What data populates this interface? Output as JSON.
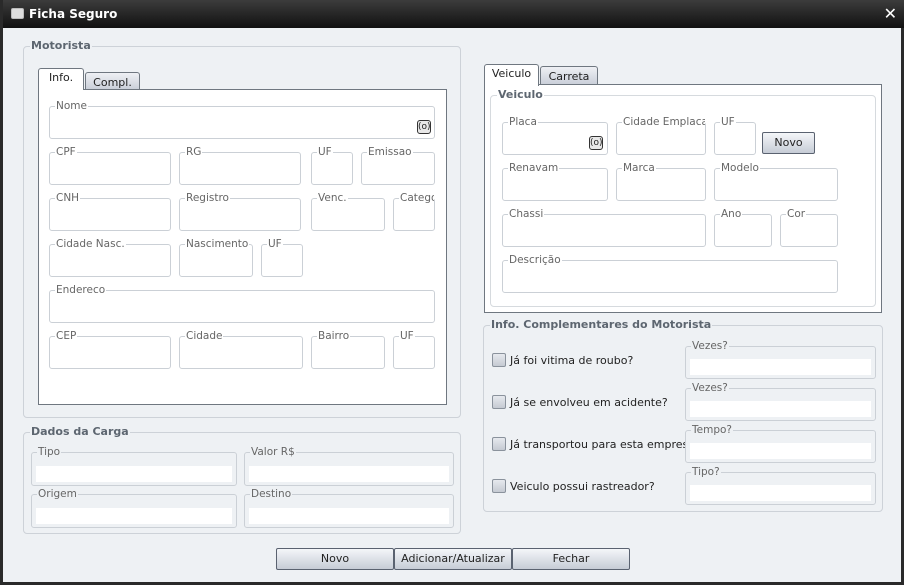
{
  "window": {
    "title": "Ficha Seguro",
    "close": "✕"
  },
  "motorista": {
    "title": "Motorista",
    "tabs": [
      "Info.",
      "Compl."
    ],
    "fields": {
      "nome": "Nome",
      "cpf": "CPF",
      "rg": "RG",
      "uf": "UF",
      "emissao": "Emissao",
      "cnh": "CNH",
      "registro": "Registro",
      "venc": "Venc.",
      "categoria": "Categoria",
      "cidade_nasc": "Cidade Nasc.",
      "nascimento": "Nascimento",
      "uf2": "UF",
      "endereco": "Endereco",
      "cep": "CEP",
      "cidade": "Cidade",
      "bairro": "Bairro",
      "uf3": "UF"
    },
    "lookup": "(o)"
  },
  "carga": {
    "title": "Dados da Carga",
    "fields": {
      "tipo": "Tipo",
      "valor": "Valor R$",
      "origem": "Origem",
      "destino": "Destino"
    }
  },
  "veiculo": {
    "tabs": [
      "Veiculo",
      "Carreta"
    ],
    "title": "Veiculo",
    "lookup": "(o)",
    "novo": "Novo",
    "fields": {
      "placa": "Placa",
      "cidade_emplacamento": "Cidade Emplacamento",
      "uf": "UF",
      "renavam": "Renavam",
      "marca": "Marca",
      "modelo": "Modelo",
      "chassi": "Chassi",
      "ano": "Ano",
      "cor": "Cor",
      "descricao": "Descrição"
    }
  },
  "complementares": {
    "title": "Info. Complementares do Motorista",
    "items": [
      {
        "label": "Já foi vitima de roubo?",
        "field": "Vezes?",
        "checked": false
      },
      {
        "label": "Já se envolveu em acidente?",
        "field": "Vezes?",
        "checked": false
      },
      {
        "label": "Já transportou para esta empresa?",
        "field": "Tempo?",
        "checked": false
      },
      {
        "label": "Veiculo possui rastreador?",
        "field": "Tipo?",
        "checked": false
      }
    ]
  },
  "buttons": {
    "novo": "Novo",
    "adicionar": "Adicionar/Atualizar",
    "fechar": "Fechar"
  }
}
